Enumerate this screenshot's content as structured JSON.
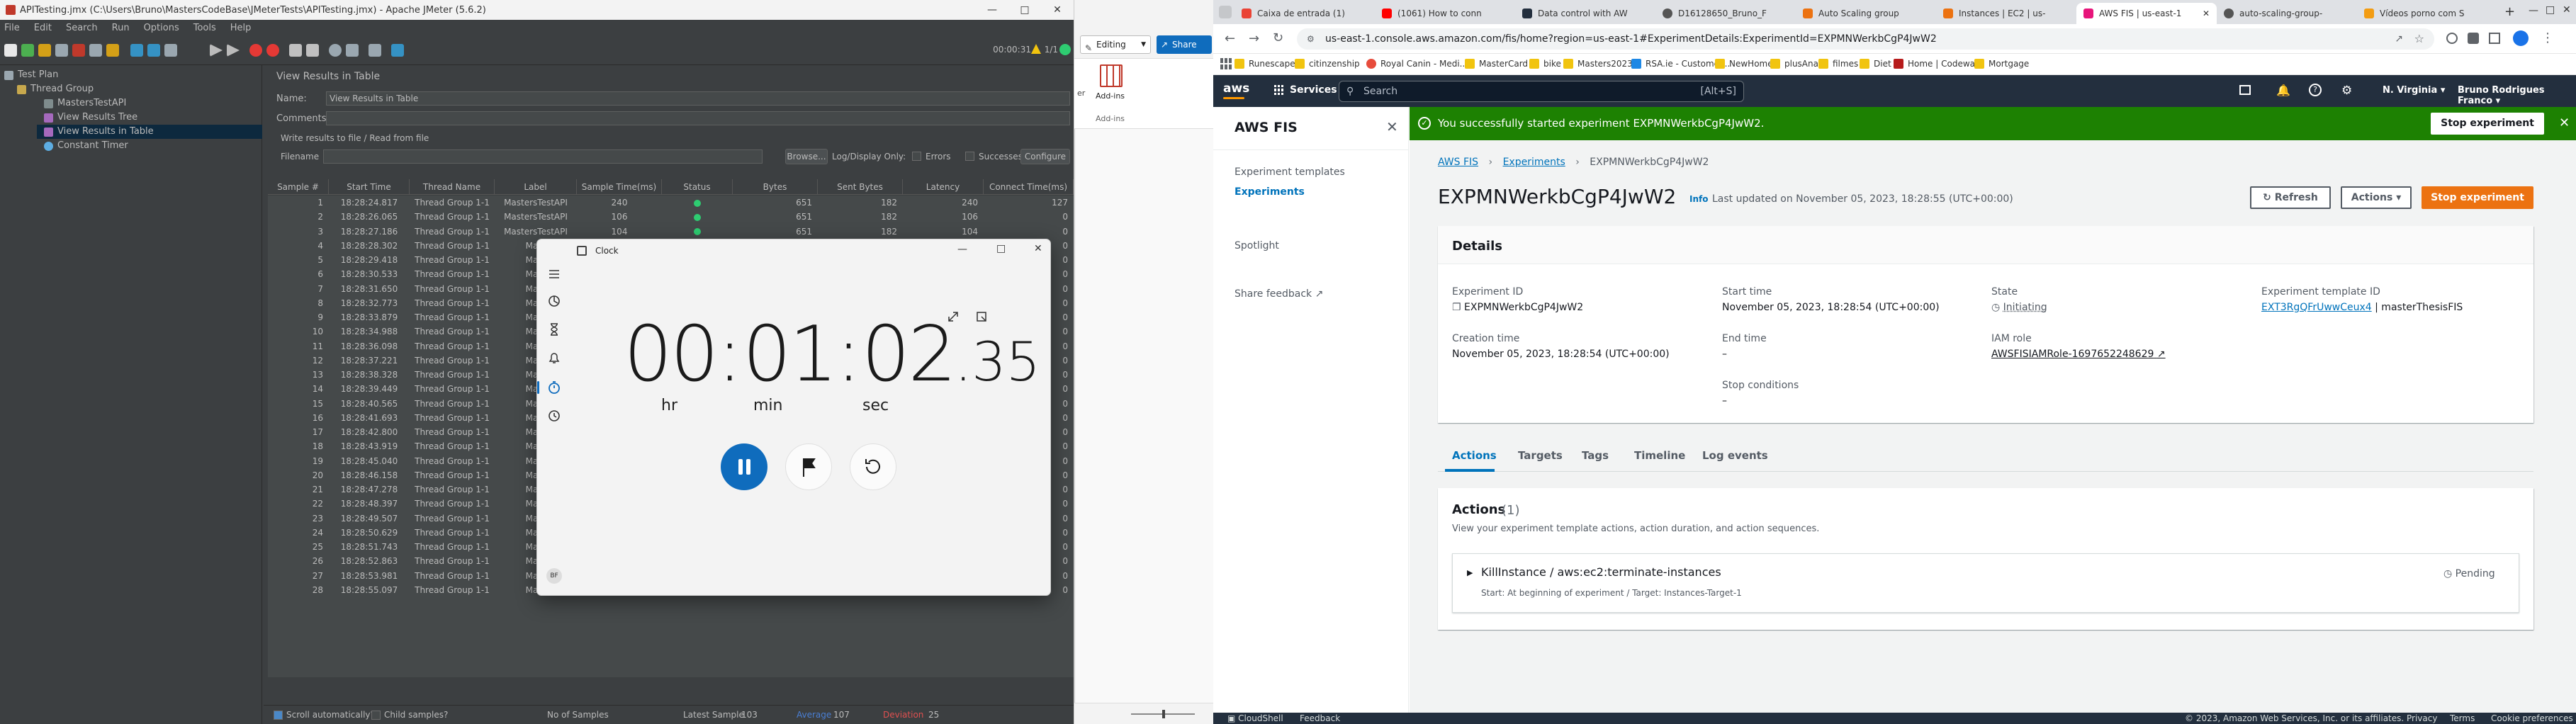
{
  "jmeter": {
    "title": "APITesting.jmx (C:\\Users\\Bruno\\MastersCodeBase\\JMeterTests\\APITesting.jmx) - Apache JMeter (5.6.2)",
    "menu": [
      "File",
      "Edit",
      "Search",
      "Run",
      "Options",
      "Tools",
      "Help"
    ],
    "timer": "00:00:31",
    "threads": "1/1",
    "tree": [
      "Test Plan",
      "Thread Group",
      "MastersTestAPI",
      "View Results Tree",
      "View Results in Table",
      "Constant Timer"
    ],
    "panel_title": "View Results in Table",
    "name_label": "Name:",
    "name_value": "View Results in Table",
    "comments_label": "Comments:",
    "write_label": "Write results to file / Read from file",
    "filename_label": "Filename",
    "browse": "Browse...",
    "log_label": "Log/Display Only:",
    "errors": "Errors",
    "successes": "Successes",
    "configure": "Configure",
    "columns": [
      "Sample #",
      "Start Time",
      "Thread Name",
      "Label",
      "Sample Time(ms)",
      "Status",
      "Bytes",
      "Sent Bytes",
      "Latency",
      "Connect Time(ms)"
    ],
    "rows": [
      [
        "1",
        "18:28:24.817",
        "Thread Group 1-1",
        "MastersTestAPI",
        "240",
        "",
        "651",
        "182",
        "240",
        "127"
      ],
      [
        "2",
        "18:28:26.065",
        "Thread Group 1-1",
        "MastersTestAPI",
        "106",
        "",
        "651",
        "182",
        "106",
        "0"
      ],
      [
        "3",
        "18:28:27.186",
        "Thread Group 1-1",
        "MastersTestAPI",
        "104",
        "",
        "651",
        "182",
        "104",
        "0"
      ],
      [
        "4",
        "18:28:28.302",
        "Thread Group 1-1",
        "Mast",
        "",
        "",
        "651",
        "182",
        "",
        "0"
      ],
      [
        "5",
        "18:28:29.418",
        "Thread Group 1-1",
        "Mast",
        "",
        "",
        "651",
        "182",
        "",
        "0"
      ],
      [
        "6",
        "18:28:30.533",
        "Thread Group 1-1",
        "Mast",
        "",
        "",
        "651",
        "182",
        "",
        "0"
      ],
      [
        "7",
        "18:28:31.650",
        "Thread Group 1-1",
        "Mast",
        "",
        "",
        "651",
        "182",
        "",
        "0"
      ],
      [
        "8",
        "18:28:32.773",
        "Thread Group 1-1",
        "Mast",
        "",
        "",
        "651",
        "182",
        "",
        "0"
      ],
      [
        "9",
        "18:28:33.879",
        "Thread Group 1-1",
        "Mast",
        "",
        "",
        "651",
        "182",
        "",
        "0"
      ],
      [
        "10",
        "18:28:34.988",
        "Thread Group 1-1",
        "Mast",
        "",
        "",
        "651",
        "182",
        "",
        "0"
      ],
      [
        "11",
        "18:28:36.098",
        "Thread Group 1-1",
        "Mast",
        "",
        "",
        "651",
        "182",
        "",
        "0"
      ],
      [
        "12",
        "18:28:37.221",
        "Thread Group 1-1",
        "Mast",
        "",
        "",
        "651",
        "182",
        "",
        "0"
      ],
      [
        "13",
        "18:28:38.328",
        "Thread Group 1-1",
        "Mast",
        "",
        "",
        "651",
        "182",
        "",
        "0"
      ],
      [
        "14",
        "18:28:39.449",
        "Thread Group 1-1",
        "Mast",
        "",
        "",
        "651",
        "182",
        "",
        "0"
      ],
      [
        "15",
        "18:28:40.565",
        "Thread Group 1-1",
        "Mast",
        "",
        "",
        "651",
        "182",
        "",
        "0"
      ],
      [
        "16",
        "18:28:41.693",
        "Thread Group 1-1",
        "Mast",
        "",
        "",
        "651",
        "182",
        "",
        "0"
      ],
      [
        "17",
        "18:28:42.800",
        "Thread Group 1-1",
        "Mast",
        "",
        "",
        "651",
        "182",
        "",
        "0"
      ],
      [
        "18",
        "18:28:43.919",
        "Thread Group 1-1",
        "Mast",
        "",
        "",
        "651",
        "182",
        "",
        "0"
      ],
      [
        "19",
        "18:28:45.040",
        "Thread Group 1-1",
        "Mast",
        "",
        "",
        "651",
        "182",
        "",
        "0"
      ],
      [
        "20",
        "18:28:46.158",
        "Thread Group 1-1",
        "Mast",
        "",
        "",
        "651",
        "182",
        "",
        "0"
      ],
      [
        "21",
        "18:28:47.278",
        "Thread Group 1-1",
        "Mast",
        "",
        "",
        "651",
        "182",
        "",
        "0"
      ],
      [
        "22",
        "18:28:48.397",
        "Thread Group 1-1",
        "Mast",
        "",
        "",
        "651",
        "182",
        "",
        "0"
      ],
      [
        "23",
        "18:28:49.507",
        "Thread Group 1-1",
        "Mast",
        "",
        "",
        "651",
        "182",
        "",
        "0"
      ],
      [
        "24",
        "18:28:50.629",
        "Thread Group 1-1",
        "Mast",
        "",
        "",
        "651",
        "182",
        "",
        "0"
      ],
      [
        "25",
        "18:28:51.743",
        "Thread Group 1-1",
        "Mast",
        "",
        "",
        "651",
        "182",
        "",
        "0"
      ],
      [
        "26",
        "18:28:52.863",
        "Thread Group 1-1",
        "Mast",
        "",
        "",
        "651",
        "182",
        "",
        "0"
      ],
      [
        "27",
        "18:28:53.981",
        "Thread Group 1-1",
        "Mast",
        "",
        "",
        "651",
        "182",
        "",
        "0"
      ],
      [
        "28",
        "18:28:55.097",
        "Thread Group 1-1",
        "Mast",
        "",
        "",
        "651",
        "182",
        "",
        "0"
      ]
    ],
    "scroll_auto": "Scroll automatically?",
    "child_samples": "Child samples?",
    "no_samples": "No of Samples",
    "latest_sample": "Latest Sample",
    "latest_value": "103",
    "average": "Average",
    "average_value": "107",
    "deviation": "Deviation",
    "deviation_value": "25"
  },
  "clock": {
    "title": "Clock",
    "hh": "00",
    "mm": "01",
    "ss": "02",
    "cs": ".35",
    "hr": "hr",
    "min": "min",
    "sec": "sec"
  },
  "excel": {
    "editing": "Editing",
    "share": "Share",
    "addins": "Add-ins",
    "addins2": "Add-ins"
  },
  "chrome": {
    "tabs": [
      "Caixa de entrada (1)",
      "(1061) How to conn",
      "Data control with AW",
      "D16128650_Bruno_F",
      "Auto Scaling group",
      "Instances | EC2 | us-",
      "AWS FIS | us-east-1",
      "auto-scaling-group-",
      "Vídeos porno com S"
    ],
    "url": "us-east-1.console.aws.amazon.com/fis/home?region=us-east-1#ExperimentDetails:ExperimentId=EXPMNWerkbCgP4JwW2",
    "bookmarks": [
      "Runescape",
      "citinzenship",
      "Royal Canin - Medi...",
      "MasterCard",
      "bike",
      "Masters2023",
      "RSA.ie - Customer...",
      "NewHome",
      "plusAna",
      "filmes",
      "Diet",
      "Home | Codewars",
      "Mortgage"
    ]
  },
  "aws": {
    "services": "Services",
    "search_placeholder": "Search",
    "search_shortcut": "[Alt+S]",
    "region": "N. Virginia",
    "user": "Bruno Rodrigues Franco",
    "side_title": "AWS FIS",
    "side_items": [
      "Experiment templates",
      "Experiments",
      "Spotlight",
      "Share feedback"
    ],
    "flash_text": "You successfully started experiment EXPMNWerkbCgP4JwW2.",
    "flash_btn": "Stop experiment",
    "crumb_fis": "AWS FIS",
    "crumb_exp": "Experiments",
    "crumb_id": "EXPMNWerkbCgP4JwW2",
    "heading": "EXPMNWerkbCgP4JwW2",
    "info": "Info",
    "updated": "Last updated on November 05, 2023, 18:28:55 (UTC+00:00)",
    "refresh": "Refresh",
    "actions": "Actions",
    "stop": "Stop experiment",
    "details_title": "Details",
    "exp_id_k": "Experiment ID",
    "exp_id_v": "EXPMNWerkbCgP4JwW2",
    "creation_k": "Creation time",
    "creation_v": "November 05, 2023, 18:28:54 (UTC+00:00)",
    "start_k": "Start time",
    "start_v": "November 05, 2023, 18:28:54 (UTC+00:00)",
    "end_k": "End time",
    "end_v": "–",
    "stopc_k": "Stop conditions",
    "stopc_v": "–",
    "state_k": "State",
    "state_v": "Initiating",
    "iam_k": "IAM role",
    "iam_v": "AWSFISIAMRole-1697652248629",
    "tmpl_k": "Experiment template ID",
    "tmpl_v": "EXT3RgQFrUwwCeux4",
    "tmpl_name": "| masterThesisFIS",
    "subtabs": [
      "Actions",
      "Targets",
      "Tags",
      "Timeline",
      "Log events"
    ],
    "actions_title": "Actions",
    "actions_count": "(1)",
    "actions_desc": "View your experiment template actions, action duration, and action sequences.",
    "action_name": "KillInstance / aws:ec2:terminate-instances",
    "action_sub": "Start: At beginning of experiment / Target: Instances-Target-1",
    "action_status": "Pending",
    "footer_cloudshell": "CloudShell",
    "footer_feedback": "Feedback",
    "footer_copy": "© 2023, Amazon Web Services, Inc. or its affiliates.",
    "footer_privacy": "Privacy",
    "footer_terms": "Terms",
    "footer_cookie": "Cookie preferences"
  },
  "colors": {
    "aws_orange": "#ec7211",
    "aws_green": "#1d8102",
    "aws_dark": "#232f3e",
    "clock_blue": "#0f6cbd"
  }
}
